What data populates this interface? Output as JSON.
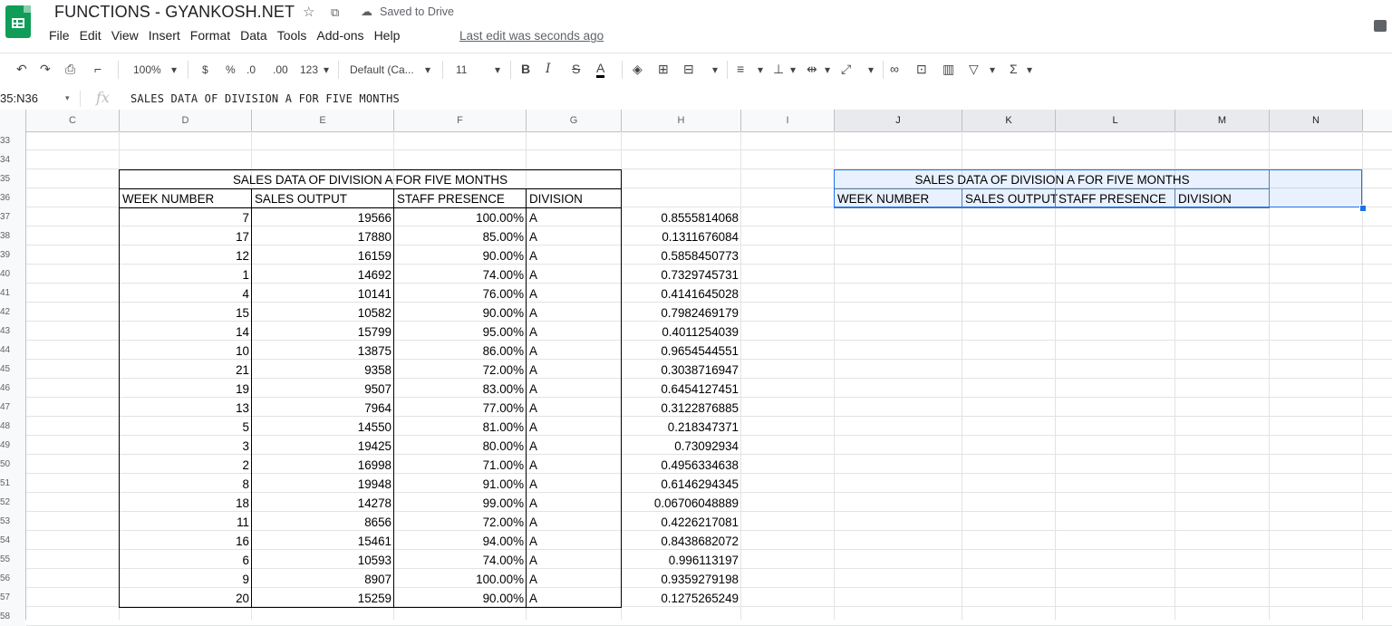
{
  "doc": {
    "title": "FUNCTIONS - GYANKOSH.NET",
    "saved_status": "Saved to Drive",
    "last_edit": "Last edit was seconds ago"
  },
  "menu": [
    "File",
    "Edit",
    "View",
    "Insert",
    "Format",
    "Data",
    "Tools",
    "Add-ons",
    "Help"
  ],
  "toolbar": {
    "zoom": "100%",
    "currency": "$",
    "percent": "%",
    "decrease_decimal": ".0",
    "increase_decimal": ".00",
    "more_formats": "123",
    "font": "Default (Ca...",
    "font_size": "11",
    "bold": "B",
    "italic": "I",
    "strikethrough": "S",
    "text_color": "A",
    "functions": "Σ"
  },
  "formula_bar": {
    "name_box": "35:N36",
    "fx": "fx",
    "content": "SALES DATA OF DIVISION A FOR FIVE MONTHS"
  },
  "columns": [
    "C",
    "D",
    "E",
    "F",
    "G",
    "H",
    "I",
    "J",
    "K",
    "L",
    "M",
    "N"
  ],
  "rows": [
    "33",
    "34",
    "35",
    "36",
    "37",
    "38",
    "39",
    "40",
    "41",
    "42",
    "43",
    "44",
    "45",
    "46",
    "47",
    "48",
    "49",
    "50",
    "51",
    "52",
    "53",
    "54",
    "55",
    "56",
    "57",
    "58"
  ],
  "table1": {
    "title": "SALES DATA OF DIVISION A FOR FIVE MONTHS",
    "headers": [
      "WEEK NUMBER",
      "SALES OUTPUT",
      "STAFF PRESENCE",
      "DIVISION"
    ],
    "rows": [
      [
        "7",
        "19566",
        "100.00%",
        "A",
        "0.8555814068"
      ],
      [
        "17",
        "17880",
        "85.00%",
        "A",
        "0.1311676084"
      ],
      [
        "12",
        "16159",
        "90.00%",
        "A",
        "0.5858450773"
      ],
      [
        "1",
        "14692",
        "74.00%",
        "A",
        "0.7329745731"
      ],
      [
        "4",
        "10141",
        "76.00%",
        "A",
        "0.4141645028"
      ],
      [
        "15",
        "10582",
        "90.00%",
        "A",
        "0.7982469179"
      ],
      [
        "14",
        "15799",
        "95.00%",
        "A",
        "0.4011254039"
      ],
      [
        "10",
        "13875",
        "86.00%",
        "A",
        "0.9654544551"
      ],
      [
        "21",
        "9358",
        "72.00%",
        "A",
        "0.3038716947"
      ],
      [
        "19",
        "9507",
        "83.00%",
        "A",
        "0.6454127451"
      ],
      [
        "13",
        "7964",
        "77.00%",
        "A",
        "0.3122876885"
      ],
      [
        "5",
        "14550",
        "81.00%",
        "A",
        "0.218347371"
      ],
      [
        "3",
        "19425",
        "80.00%",
        "A",
        "0.73092934"
      ],
      [
        "2",
        "16998",
        "71.00%",
        "A",
        "0.4956334638"
      ],
      [
        "8",
        "19948",
        "91.00%",
        "A",
        "0.6146294345"
      ],
      [
        "18",
        "14278",
        "99.00%",
        "A",
        "0.06706048889"
      ],
      [
        "11",
        "8656",
        "72.00%",
        "A",
        "0.4226217081"
      ],
      [
        "16",
        "15461",
        "94.00%",
        "A",
        "0.8438682072"
      ],
      [
        "6",
        "10593",
        "74.00%",
        "A",
        "0.996113197"
      ],
      [
        "9",
        "8907",
        "100.00%",
        "A",
        "0.9359279198"
      ],
      [
        "20",
        "15259",
        "90.00%",
        "A",
        "0.1275265249"
      ]
    ]
  },
  "table2": {
    "title": "SALES DATA OF DIVISION A FOR FIVE MONTHS",
    "headers": [
      "WEEK NUMBER",
      "SALES OUTPUT",
      "STAFF PRESENCE",
      "DIVISION"
    ]
  },
  "colors": {
    "brand": "#0f9d58",
    "selection": "#1a73e8"
  }
}
